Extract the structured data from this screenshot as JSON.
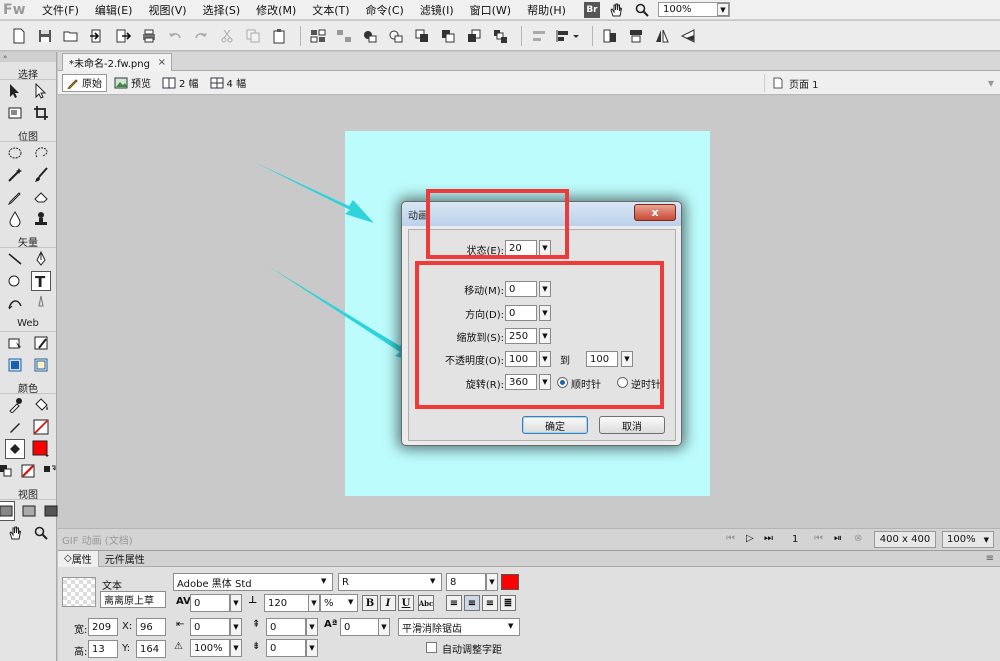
{
  "app": {
    "logo": "Fw"
  },
  "menu": {
    "items": [
      "文件(F)",
      "编辑(E)",
      "视图(V)",
      "选择(S)",
      "修改(M)",
      "文本(T)",
      "命令(C)",
      "滤镜(I)",
      "窗口(W)",
      "帮助(H)"
    ],
    "bridge_label": "Br",
    "zoom_value": "100%"
  },
  "tools_panel": {
    "grip": "»",
    "sections": {
      "select": "选择",
      "bitmap": "位图",
      "vector": "矢量",
      "web": "Web",
      "colors": "颜色",
      "view": "视图"
    }
  },
  "document": {
    "tab_title": "*未命名-2.fw.png",
    "tab_close": "×"
  },
  "view_bar": {
    "original": "原始",
    "preview": "预览",
    "two_up": "2 幅",
    "four_up": "4 幅",
    "page": "页面 1"
  },
  "status_bar": {
    "gif_label": "GIF 动画 (文档)",
    "frame": "1",
    "canvas_size": "400 x 400",
    "zoom": "100%"
  },
  "properties": {
    "tabs": [
      "属性",
      "元件属性"
    ],
    "object_type": "文本",
    "object_name": "离离原上草",
    "font": "Adobe 黑体 Std",
    "style": "R",
    "size": "8",
    "fill_color": "#ff0000",
    "kerning": "0",
    "leading": "120",
    "leading_unit": "%",
    "bold": "B",
    "italic": "I",
    "underline": "U",
    "width_label": "宽:",
    "width": "209",
    "height_label": "高:",
    "height": "13",
    "x_label": "X:",
    "x": "96",
    "y_label": "Y:",
    "y": "164",
    "indent": "0",
    "space_before": "0",
    "baseline_shift": "0",
    "horizontal_scale": "100%",
    "space_after": "0",
    "anti_alias": "平滑消除锯齿",
    "auto_kern": "自动调整字距"
  },
  "dialog": {
    "title": "动画",
    "close": "x",
    "state_label": "状态(E):",
    "state_value": "20",
    "move_label": "移动(M):",
    "move_value": "0",
    "direction_label": "方向(D):",
    "direction_value": "0",
    "scale_label": "缩放到(S):",
    "scale_value": "250",
    "opacity_label": "不透明度(O):",
    "opacity_from": "100",
    "opacity_to_label": "到",
    "opacity_to": "100",
    "rotate_label": "旋转(R):",
    "rotate_value": "360",
    "clockwise": "顺时针",
    "counter_clockwise": "逆时针",
    "ok": "确定",
    "cancel": "取消"
  },
  "colors": {
    "highlight": "#ef3a3a",
    "arrow": "#2fd3dc",
    "artboard": "#bdfcfc"
  }
}
